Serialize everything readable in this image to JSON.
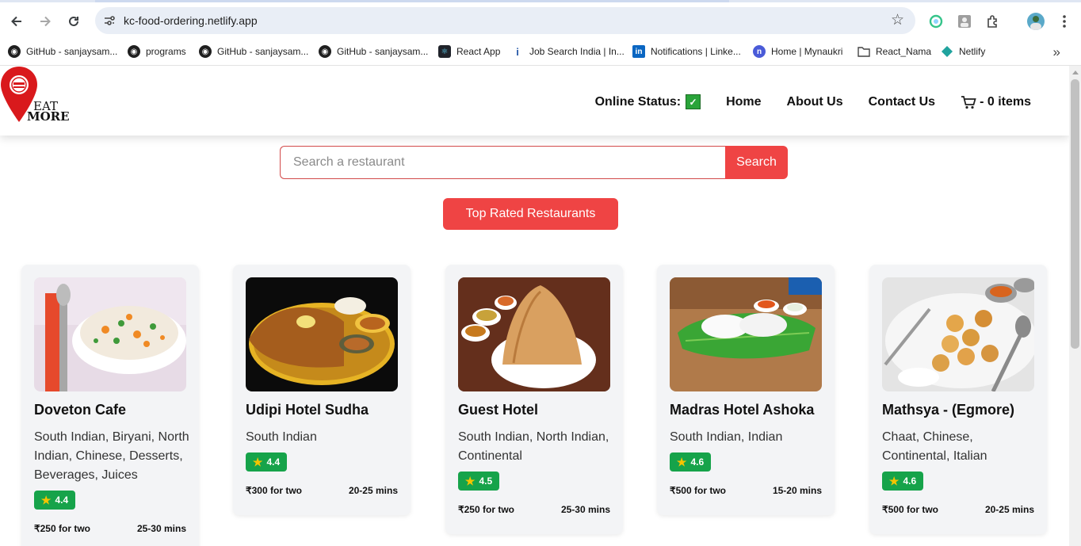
{
  "browser": {
    "url": "kc-food-ordering.netlify.app",
    "bookmarks": [
      {
        "label": "GitHub - sanjaysam...",
        "icon": "github-icon"
      },
      {
        "label": "programs",
        "icon": "github-icon"
      },
      {
        "label": "GitHub - sanjaysam...",
        "icon": "github-icon"
      },
      {
        "label": "GitHub - sanjaysam...",
        "icon": "github-icon"
      },
      {
        "label": "React App",
        "icon": "react-icon"
      },
      {
        "label": "Job Search India | In...",
        "icon": "indeed-icon"
      },
      {
        "label": "Notifications | Linke...",
        "icon": "linkedin-icon"
      },
      {
        "label": "Home | Mynaukri",
        "icon": "naukri-icon"
      },
      {
        "label": "React_Nama",
        "icon": "folder-icon"
      },
      {
        "label": "Netlify",
        "icon": "netlify-icon"
      }
    ]
  },
  "header": {
    "logo": {
      "line1": "EAT",
      "line2": "MORE"
    },
    "online_status_label": "Online Status:",
    "online_status_icon": "✅",
    "nav": {
      "home": "Home",
      "about": "About Us",
      "contact": "Contact Us"
    },
    "cart_label": "- 0 items"
  },
  "search": {
    "placeholder": "Search a restaurant",
    "button_label": "Search"
  },
  "top_rated_label": "Top Rated Restaurants",
  "restaurants": [
    {
      "name": "Doveton Cafe",
      "cuisines": "South Indian, Biryani, North Indian, Chinese, Desserts, Beverages, Juices",
      "rating": "4.4",
      "cost": "₹250 for two",
      "time": "25-30 mins"
    },
    {
      "name": "Udipi Hotel Sudha",
      "cuisines": "South Indian",
      "rating": "4.4",
      "cost": "₹300 for two",
      "time": "20-25 mins"
    },
    {
      "name": "Guest Hotel",
      "cuisines": "South Indian, North Indian, Continental",
      "rating": "4.5",
      "cost": "₹250 for two",
      "time": "25-30 mins"
    },
    {
      "name": "Madras Hotel Ashoka",
      "cuisines": "South Indian, Indian",
      "rating": "4.6",
      "cost": "₹500 for two",
      "time": "15-20 mins"
    },
    {
      "name": "Mathsya - (Egmore)",
      "cuisines": "Chaat, Chinese, Continental, Italian",
      "rating": "4.6",
      "cost": "₹500 for two",
      "time": "20-25 mins"
    }
  ],
  "colors": {
    "accent": "#ef4444",
    "rating_bg": "#16a34a",
    "card_bg": "#f3f4f6"
  }
}
